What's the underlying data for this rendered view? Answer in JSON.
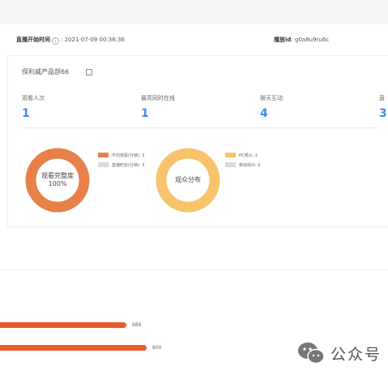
{
  "header": {
    "live_start_label": "直播开始时间",
    "live_start_value": ": 2021-07-09 00:36:36",
    "play_id_label": "播放id",
    "play_id_value": ": g0a8u9ru6c"
  },
  "card": {
    "title": "保利威产品部66",
    "stats": [
      {
        "label": "观看人次",
        "value": "1"
      },
      {
        "label": "最高同时在线",
        "value": "1"
      },
      {
        "label": "聊天互动",
        "value": "4"
      },
      {
        "label": "直",
        "value": "3"
      }
    ]
  },
  "donut_completion": {
    "center_line1": "观看完整度",
    "center_line2": "100%",
    "legend": [
      {
        "label": "平均观看(分钟): 3",
        "color": "#e8804a"
      },
      {
        "label": "直播时长(分钟): 3",
        "color": "#d9d9d9"
      }
    ]
  },
  "donut_audience": {
    "center": "观众分布",
    "legend": [
      {
        "label": "PC观众: 1",
        "color": "#f7c46c"
      },
      {
        "label": "移动观众: 0",
        "color": "#d9d9d9"
      }
    ]
  },
  "chart_data": {
    "type": "bar",
    "orientation": "horizontal",
    "values": [
      689,
      800
    ],
    "title": "",
    "xlabel": "",
    "ylabel": ""
  },
  "watermark": {
    "text": "公众号",
    "icon": "wechat-icon",
    "color": "#666666"
  },
  "colors": {
    "accent_blue": "#3a8ee6",
    "donut_orange": "#e8804a",
    "donut_yellow": "#f7c46c",
    "bar_orange": "#e85a2b"
  }
}
